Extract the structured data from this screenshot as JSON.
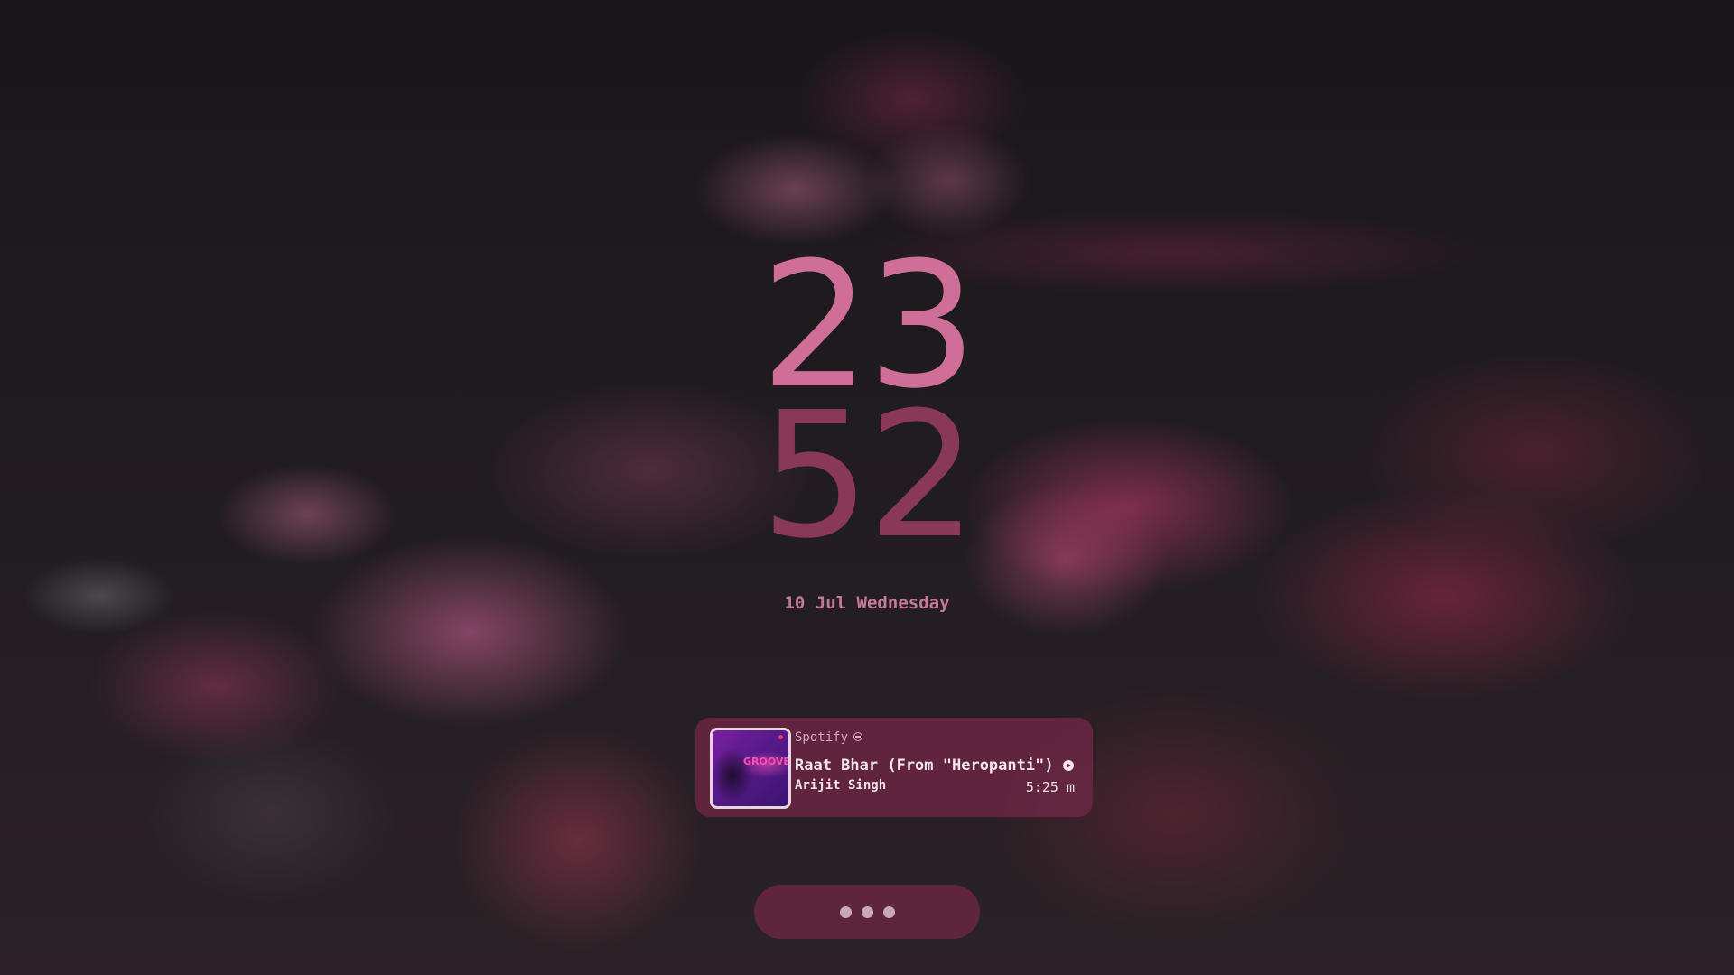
{
  "lockscreen": {
    "clock": {
      "hours": "23",
      "minutes": "52"
    },
    "date": "10 Jul Wednesday"
  },
  "media": {
    "app": "Spotify",
    "app_icon": "spotify-icon",
    "title": "Raat Bhar (From \"Heropanti\")",
    "artist": "Arijit Singh",
    "duration": "5:25 m",
    "album_art_text": "GROOVE",
    "play_icon": "play-icon"
  },
  "password_dots": {
    "count": 3
  },
  "colors": {
    "accent": "#cf6f98",
    "accent_dim": "#8a3858",
    "card_bg": "#6e2644",
    "text_light": "#f3e6ec"
  }
}
